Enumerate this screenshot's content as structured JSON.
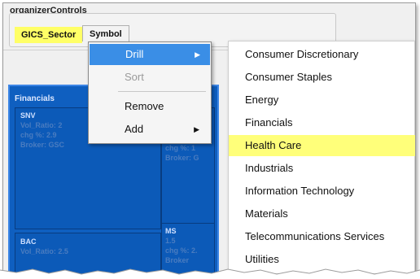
{
  "organizer": {
    "title": "organizerControls",
    "chips": [
      {
        "label": "GICS_Sector",
        "highlighted": true
      },
      {
        "label": "Symbol",
        "highlighted": false
      }
    ]
  },
  "treemap": {
    "sector_label": "Financials",
    "cells": [
      {
        "symbol": "SNV",
        "line1": "Vol_Ratio: 2",
        "line2": "chg %: 2.9",
        "line3": "Broker: GSC"
      },
      {
        "symbol": "",
        "line1": "chg %: 1",
        "line2": "Broker: G",
        "line3": ""
      },
      {
        "symbol": "MS",
        "line1": "1.5",
        "line2": "chg %: 2.",
        "line3": "Broker"
      },
      {
        "symbol": "BAC",
        "line1": "Vol_Ratio: 2.5",
        "line2": "",
        "line3": ""
      }
    ]
  },
  "context_menu": {
    "items": [
      {
        "label": "Drill",
        "enabled": true,
        "submenu": true,
        "active": true
      },
      {
        "label": "Sort",
        "enabled": false,
        "submenu": false
      },
      {
        "label": "Remove",
        "enabled": true,
        "submenu": false
      },
      {
        "label": "Add",
        "enabled": true,
        "submenu": true
      }
    ]
  },
  "submenu": {
    "items": [
      {
        "label": "Consumer Discretionary",
        "highlighted": false
      },
      {
        "label": "Consumer Staples",
        "highlighted": false
      },
      {
        "label": "Energy",
        "highlighted": false
      },
      {
        "label": "Financials",
        "highlighted": false
      },
      {
        "label": "Health Care",
        "highlighted": true
      },
      {
        "label": "Industrials",
        "highlighted": false
      },
      {
        "label": "Information Technology",
        "highlighted": false
      },
      {
        "label": "Materials",
        "highlighted": false
      },
      {
        "label": "Telecommunications Services",
        "highlighted": false
      },
      {
        "label": "Utilities",
        "highlighted": false
      }
    ]
  },
  "colors": {
    "highlight": "#ffff7a",
    "menu_active": "#3a8ee6",
    "treemap_blue": "#0c5ab8"
  }
}
